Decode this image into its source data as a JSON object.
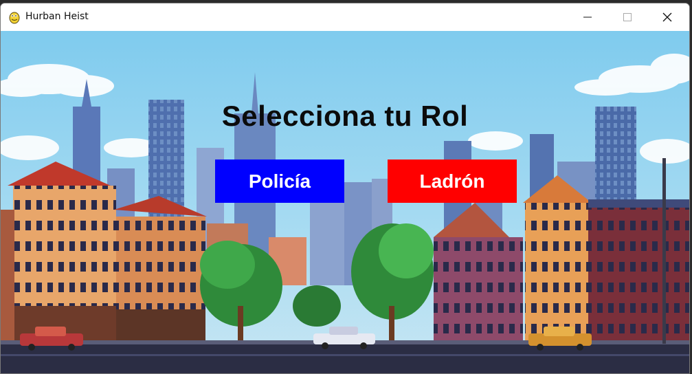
{
  "window": {
    "title": "Hurban Heist",
    "controls": {
      "minimize": "minimize-icon",
      "maximize": "maximize-icon",
      "close": "close-icon"
    }
  },
  "menu": {
    "heading": "Selecciona tu Rol",
    "police_label": "Policía",
    "thief_label": "Ladrón"
  },
  "colors": {
    "police": "#0000ff",
    "thief": "#ff0000",
    "heading": "#0b0b0b",
    "sky": "#8fd3ee"
  }
}
